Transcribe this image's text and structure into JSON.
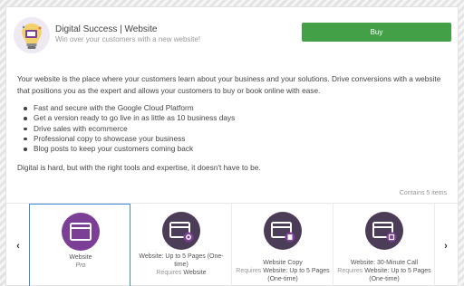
{
  "header": {
    "title": "Digital Success | Website",
    "subtitle": "Win over your customers with a new website!",
    "buy_label": "Buy"
  },
  "description": {
    "intro": "Your website is the place where your customers learn about your business and your solutions. Drive conversions with a website that positions you as the expert and allows your customers to buy or book online with ease.",
    "bullets": [
      "Fast and secure with the Google Cloud Platform",
      "Get a version ready to go live in as little as 10 business days",
      "Drive sales with ecommerce",
      "Professional copy to showcase your business",
      "Blog posts to keep your customers coming back"
    ],
    "closing": "Digital is hard, but with the right tools and expertise, it doesn't have to be."
  },
  "contains_label": "Contains 5 items",
  "carousel": {
    "prev_icon": "chevron-left-icon",
    "next_icon": "chevron-right-icon",
    "prev_glyph": "‹",
    "next_glyph": "›",
    "items": [
      {
        "name": "Website",
        "sub": "Pro",
        "requires_label": "",
        "requires_value": "",
        "selected": true
      },
      {
        "name": "Website: Up to 5 Pages (One-time)",
        "sub": "",
        "requires_label": "Requires",
        "requires_value": "Website",
        "selected": false
      },
      {
        "name": "Website Copy",
        "sub": "",
        "requires_label": "Requires",
        "requires_value": "Website: Up to 5 Pages (One-time)",
        "selected": false
      },
      {
        "name": "Website: 30-Minute Call",
        "sub": "",
        "requires_label": "Requires",
        "requires_value": "Website: Up to 5 Pages (One-time)",
        "selected": false
      }
    ]
  },
  "colors": {
    "buy_button": "#43a047",
    "icon_purple": "#7b3f95",
    "icon_dark": "#4b3c57",
    "selected_border": "#3f8ad8"
  }
}
